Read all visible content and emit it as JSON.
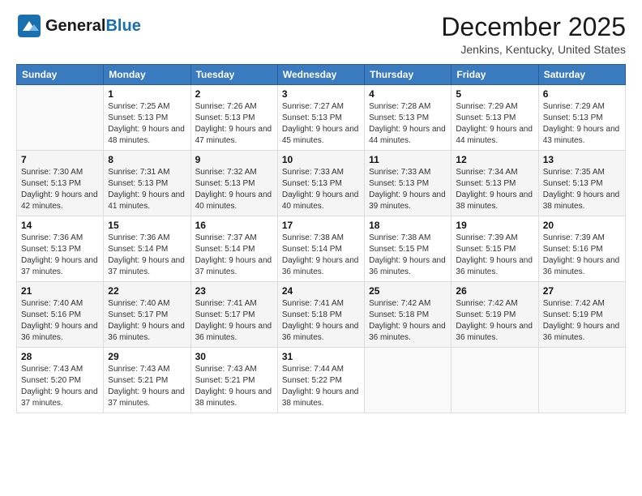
{
  "header": {
    "logo_general": "General",
    "logo_blue": "Blue",
    "month_title": "December 2025",
    "location": "Jenkins, Kentucky, United States"
  },
  "weekdays": [
    "Sunday",
    "Monday",
    "Tuesday",
    "Wednesday",
    "Thursday",
    "Friday",
    "Saturday"
  ],
  "weeks": [
    [
      {
        "day": "",
        "sunrise": "",
        "sunset": "",
        "daylight": ""
      },
      {
        "day": "1",
        "sunrise": "Sunrise: 7:25 AM",
        "sunset": "Sunset: 5:13 PM",
        "daylight": "Daylight: 9 hours and 48 minutes."
      },
      {
        "day": "2",
        "sunrise": "Sunrise: 7:26 AM",
        "sunset": "Sunset: 5:13 PM",
        "daylight": "Daylight: 9 hours and 47 minutes."
      },
      {
        "day": "3",
        "sunrise": "Sunrise: 7:27 AM",
        "sunset": "Sunset: 5:13 PM",
        "daylight": "Daylight: 9 hours and 45 minutes."
      },
      {
        "day": "4",
        "sunrise": "Sunrise: 7:28 AM",
        "sunset": "Sunset: 5:13 PM",
        "daylight": "Daylight: 9 hours and 44 minutes."
      },
      {
        "day": "5",
        "sunrise": "Sunrise: 7:29 AM",
        "sunset": "Sunset: 5:13 PM",
        "daylight": "Daylight: 9 hours and 44 minutes."
      },
      {
        "day": "6",
        "sunrise": "Sunrise: 7:29 AM",
        "sunset": "Sunset: 5:13 PM",
        "daylight": "Daylight: 9 hours and 43 minutes."
      }
    ],
    [
      {
        "day": "7",
        "sunrise": "Sunrise: 7:30 AM",
        "sunset": "Sunset: 5:13 PM",
        "daylight": "Daylight: 9 hours and 42 minutes."
      },
      {
        "day": "8",
        "sunrise": "Sunrise: 7:31 AM",
        "sunset": "Sunset: 5:13 PM",
        "daylight": "Daylight: 9 hours and 41 minutes."
      },
      {
        "day": "9",
        "sunrise": "Sunrise: 7:32 AM",
        "sunset": "Sunset: 5:13 PM",
        "daylight": "Daylight: 9 hours and 40 minutes."
      },
      {
        "day": "10",
        "sunrise": "Sunrise: 7:33 AM",
        "sunset": "Sunset: 5:13 PM",
        "daylight": "Daylight: 9 hours and 40 minutes."
      },
      {
        "day": "11",
        "sunrise": "Sunrise: 7:33 AM",
        "sunset": "Sunset: 5:13 PM",
        "daylight": "Daylight: 9 hours and 39 minutes."
      },
      {
        "day": "12",
        "sunrise": "Sunrise: 7:34 AM",
        "sunset": "Sunset: 5:13 PM",
        "daylight": "Daylight: 9 hours and 38 minutes."
      },
      {
        "day": "13",
        "sunrise": "Sunrise: 7:35 AM",
        "sunset": "Sunset: 5:13 PM",
        "daylight": "Daylight: 9 hours and 38 minutes."
      }
    ],
    [
      {
        "day": "14",
        "sunrise": "Sunrise: 7:36 AM",
        "sunset": "Sunset: 5:13 PM",
        "daylight": "Daylight: 9 hours and 37 minutes."
      },
      {
        "day": "15",
        "sunrise": "Sunrise: 7:36 AM",
        "sunset": "Sunset: 5:14 PM",
        "daylight": "Daylight: 9 hours and 37 minutes."
      },
      {
        "day": "16",
        "sunrise": "Sunrise: 7:37 AM",
        "sunset": "Sunset: 5:14 PM",
        "daylight": "Daylight: 9 hours and 37 minutes."
      },
      {
        "day": "17",
        "sunrise": "Sunrise: 7:38 AM",
        "sunset": "Sunset: 5:14 PM",
        "daylight": "Daylight: 9 hours and 36 minutes."
      },
      {
        "day": "18",
        "sunrise": "Sunrise: 7:38 AM",
        "sunset": "Sunset: 5:15 PM",
        "daylight": "Daylight: 9 hours and 36 minutes."
      },
      {
        "day": "19",
        "sunrise": "Sunrise: 7:39 AM",
        "sunset": "Sunset: 5:15 PM",
        "daylight": "Daylight: 9 hours and 36 minutes."
      },
      {
        "day": "20",
        "sunrise": "Sunrise: 7:39 AM",
        "sunset": "Sunset: 5:16 PM",
        "daylight": "Daylight: 9 hours and 36 minutes."
      }
    ],
    [
      {
        "day": "21",
        "sunrise": "Sunrise: 7:40 AM",
        "sunset": "Sunset: 5:16 PM",
        "daylight": "Daylight: 9 hours and 36 minutes."
      },
      {
        "day": "22",
        "sunrise": "Sunrise: 7:40 AM",
        "sunset": "Sunset: 5:17 PM",
        "daylight": "Daylight: 9 hours and 36 minutes."
      },
      {
        "day": "23",
        "sunrise": "Sunrise: 7:41 AM",
        "sunset": "Sunset: 5:17 PM",
        "daylight": "Daylight: 9 hours and 36 minutes."
      },
      {
        "day": "24",
        "sunrise": "Sunrise: 7:41 AM",
        "sunset": "Sunset: 5:18 PM",
        "daylight": "Daylight: 9 hours and 36 minutes."
      },
      {
        "day": "25",
        "sunrise": "Sunrise: 7:42 AM",
        "sunset": "Sunset: 5:18 PM",
        "daylight": "Daylight: 9 hours and 36 minutes."
      },
      {
        "day": "26",
        "sunrise": "Sunrise: 7:42 AM",
        "sunset": "Sunset: 5:19 PM",
        "daylight": "Daylight: 9 hours and 36 minutes."
      },
      {
        "day": "27",
        "sunrise": "Sunrise: 7:42 AM",
        "sunset": "Sunset: 5:19 PM",
        "daylight": "Daylight: 9 hours and 36 minutes."
      }
    ],
    [
      {
        "day": "28",
        "sunrise": "Sunrise: 7:43 AM",
        "sunset": "Sunset: 5:20 PM",
        "daylight": "Daylight: 9 hours and 37 minutes."
      },
      {
        "day": "29",
        "sunrise": "Sunrise: 7:43 AM",
        "sunset": "Sunset: 5:21 PM",
        "daylight": "Daylight: 9 hours and 37 minutes."
      },
      {
        "day": "30",
        "sunrise": "Sunrise: 7:43 AM",
        "sunset": "Sunset: 5:21 PM",
        "daylight": "Daylight: 9 hours and 38 minutes."
      },
      {
        "day": "31",
        "sunrise": "Sunrise: 7:44 AM",
        "sunset": "Sunset: 5:22 PM",
        "daylight": "Daylight: 9 hours and 38 minutes."
      },
      {
        "day": "",
        "sunrise": "",
        "sunset": "",
        "daylight": ""
      },
      {
        "day": "",
        "sunrise": "",
        "sunset": "",
        "daylight": ""
      },
      {
        "day": "",
        "sunrise": "",
        "sunset": "",
        "daylight": ""
      }
    ]
  ]
}
